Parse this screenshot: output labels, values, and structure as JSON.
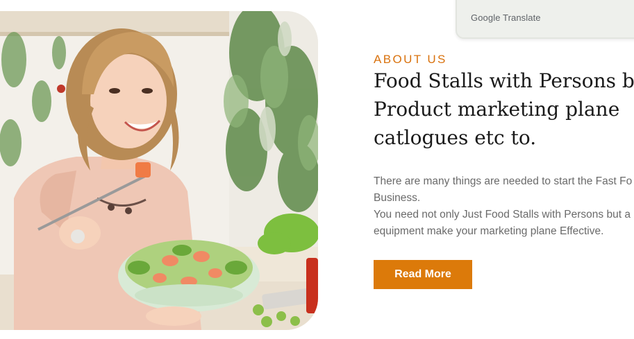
{
  "translate_widget": {
    "brand": "Google",
    "label": "Translate"
  },
  "about": {
    "eyebrow": "ABOUT US",
    "headline_lines": [
      "Food Stalls with Persons bu",
      "Product marketing plane",
      "catlogues etc to."
    ],
    "body_lines": [
      "There are many things are needed to start the Fast Fo",
      "Business.",
      "You need not only Just Food Stalls with Persons but a",
      "equipment make your marketing plane Effective."
    ],
    "button_label": "Read More"
  },
  "colors": {
    "accent": "#d9720e",
    "button": "#dc7a0a",
    "heading": "#1a1a1a",
    "body": "#6a6a6a"
  }
}
